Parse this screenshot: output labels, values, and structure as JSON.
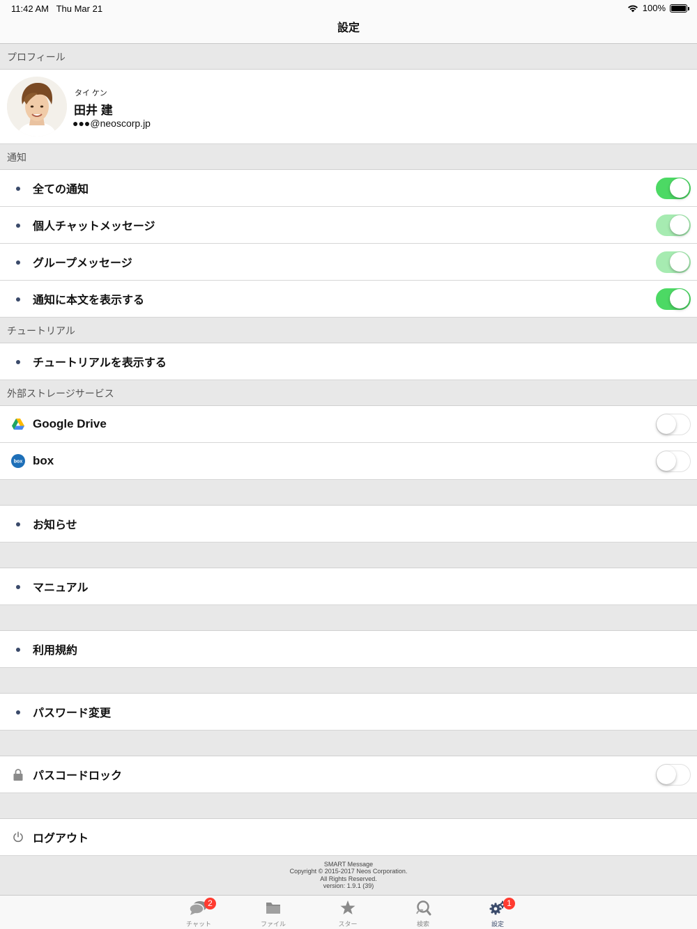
{
  "status_bar": {
    "time": "11:42 AM",
    "date": "Thu Mar 21",
    "battery": "100%"
  },
  "nav": {
    "title": "設定"
  },
  "sections": {
    "profile": "プロフィール",
    "notifications": "通知",
    "tutorial": "チュートリアル",
    "storage": "外部ストレージサービス"
  },
  "profile": {
    "kana": "タイ ケン",
    "name": "田井 建",
    "email": "●●●@neoscorp.jp"
  },
  "notifications": [
    {
      "label": "全ての通知",
      "on": true
    },
    {
      "label": "個人チャットメッセージ",
      "on": true
    },
    {
      "label": "グループメッセージ",
      "on": true
    },
    {
      "label": "通知に本文を表示する",
      "on": true
    }
  ],
  "tutorial": {
    "show_label": "チュートリアルを表示する"
  },
  "storage": [
    {
      "label": "Google Drive",
      "icon": "google-drive-icon",
      "on": false
    },
    {
      "label": "box",
      "icon": "box-icon",
      "on": false
    }
  ],
  "box_icon_text": "box",
  "menu": {
    "news": "お知らせ",
    "manual": "マニュアル",
    "terms": "利用規約",
    "password": "パスワード変更",
    "passcode": "パスコードロック",
    "logout": "ログアウト"
  },
  "passcode_on": false,
  "footer": {
    "app": "SMART Message",
    "copyright": "Copyright © 2015-2017 Neos Corporation.",
    "rights": "All Rights Reserved.",
    "version": "version: 1.9.1 (39)"
  },
  "tabs": [
    {
      "label": "チャット",
      "icon": "chat-bubbles-icon",
      "badge": "2"
    },
    {
      "label": "ファイル",
      "icon": "folder-icon"
    },
    {
      "label": "スター",
      "icon": "star-icon"
    },
    {
      "label": "検索",
      "icon": "search-icon"
    },
    {
      "label": "設定",
      "icon": "gear-icon",
      "badge": "1",
      "active": true
    }
  ],
  "colors": {
    "toggle_on": "#4cd964",
    "badge": "#ff3b30",
    "bullet": "#3a4a6a"
  }
}
